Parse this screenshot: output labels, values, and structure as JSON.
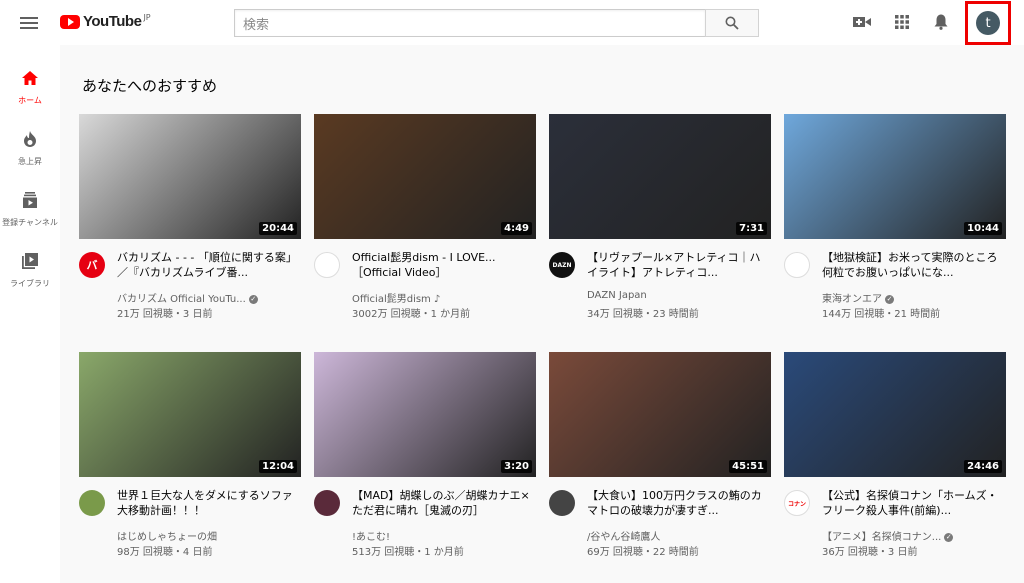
{
  "header": {
    "logo_text": "YouTube",
    "logo_region": "JP",
    "search_placeholder": "検索",
    "avatar_letter": "t"
  },
  "sidebar": {
    "items": [
      {
        "label": "ホーム",
        "icon": "home-icon",
        "active": true
      },
      {
        "label": "急上昇",
        "icon": "flame-icon",
        "active": false
      },
      {
        "label": "登録チャンネル",
        "icon": "subscriptions-icon",
        "active": false
      },
      {
        "label": "ライブラリ",
        "icon": "library-icon",
        "active": false
      }
    ]
  },
  "main": {
    "section_title": "あなたへのおすすめ",
    "videos": [
      {
        "title": "バカリズム - - - 「順位に関する案」／『バカリズムライブ番...",
        "channel": "バカリズム Official YouTu...",
        "verified": true,
        "meta": "21万 回視聴・3 日前",
        "duration": "20:44",
        "thumb_color": "#d9d9d9",
        "avatar_color": "#e60012",
        "avatar_text": "バ"
      },
      {
        "title": "Official髭男dism - I LOVE... ［Official Video］",
        "channel": "Official髭男dism",
        "note": "♪",
        "meta": "3002万 回視聴・1 か月前",
        "duration": "4:49",
        "thumb_color": "#5a3a22",
        "avatar_color": "#ffffff",
        "avatar_text": ""
      },
      {
        "title": "【リヴァプール×アトレティコ｜ハイライト】アトレティコ...",
        "channel": "DAZN Japan",
        "meta": "34万 回視聴・23 時間前",
        "duration": "7:31",
        "thumb_color": "#2b2f3a",
        "avatar_color": "#111111",
        "avatar_text": "DAZN"
      },
      {
        "title": "【地獄検証】お米って実際のところ何粒でお腹いっぱいにな...",
        "channel": "東海オンエア",
        "verified": true,
        "meta": "144万 回視聴・21 時間前",
        "duration": "10:44",
        "thumb_color": "#6fa8dc",
        "avatar_color": "#ffffff",
        "avatar_text": ""
      },
      {
        "title": "世界１巨大な人をダメにするソファ大移動計画！！！",
        "channel": "はじめしゃちょーの畑",
        "meta": "98万 回視聴・4 日前",
        "duration": "12:04",
        "thumb_color": "#8aa86a",
        "avatar_color": "#7a9a4a",
        "avatar_text": ""
      },
      {
        "title": "【MAD】胡蝶しのぶ／胡蝶カナエ×ただ君に晴れ［鬼滅の刃］",
        "channel": "!あこむ!",
        "meta": "513万 回視聴・1 か月前",
        "duration": "3:20",
        "thumb_color": "#cdb7d9",
        "avatar_color": "#5a2a3a",
        "avatar_text": ""
      },
      {
        "title": "【大食い】100万円クラスの鮪のカマトロの破壊力が凄すぎ...",
        "channel": "/谷やん谷崎鷹人",
        "meta": "69万 回視聴・22 時間前",
        "duration": "45:51",
        "thumb_color": "#7a4a3a",
        "avatar_color": "#444444",
        "avatar_text": ""
      },
      {
        "title": "【公式】名探偵コナン「ホームズ・フリーク殺人事件(前編)...",
        "channel": "【アニメ】名探偵コナン...",
        "verified": true,
        "meta": "36万 回視聴・3 日前",
        "duration": "24:46",
        "thumb_color": "#2a4a7a",
        "avatar_color": "#ffffff",
        "avatar_text": "コナン"
      }
    ]
  }
}
